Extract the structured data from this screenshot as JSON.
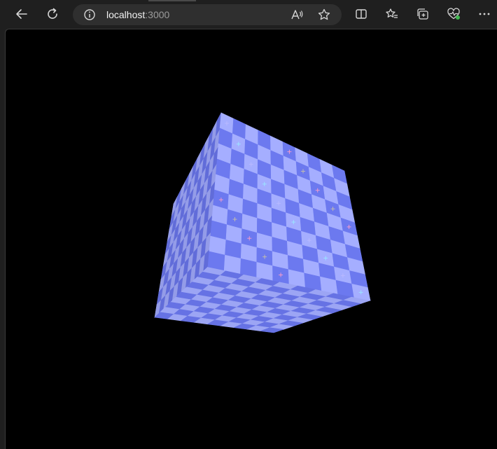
{
  "browser": {
    "address": {
      "host": "localhost",
      "port": ":3000"
    },
    "icons": {
      "back": "arrow-left-icon",
      "refresh": "refresh-icon",
      "info": "info-icon",
      "read_aloud": "read-aloud-icon",
      "favorite": "star-icon",
      "split_screen": "split-screen-icon",
      "favorites": "favorites-list-icon",
      "collections": "collections-icon",
      "browser_essentials": "heart-pulse-icon",
      "more": "more-dots-icon"
    }
  },
  "scene": {
    "background": "#000000",
    "cube": {
      "texture": "checkerboard",
      "checker_light": "#a5aeff",
      "checker_dark": "#6c79ef",
      "marker_colors": [
        "#b9b9ff",
        "#ff9ec8",
        "#9ae8ff",
        "#c9c2a8"
      ]
    }
  }
}
